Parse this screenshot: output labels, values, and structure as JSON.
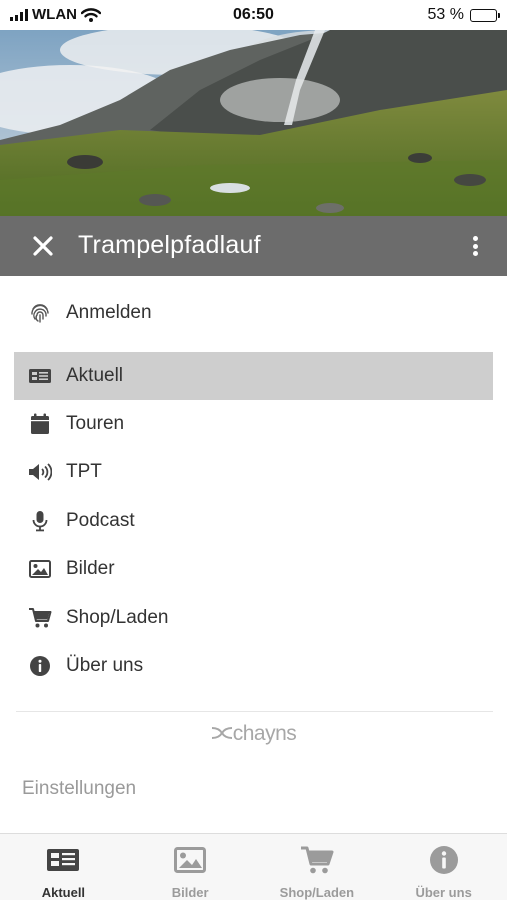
{
  "status_bar": {
    "carrier": "WLAN",
    "time": "06:50",
    "battery_percent": "53 %",
    "battery_level": 0.53
  },
  "header": {
    "title": "Trampelpfadlauf",
    "background": "#6c6c6c"
  },
  "login": {
    "label": "Anmelden",
    "icon": "fingerprint-icon"
  },
  "menu": {
    "items": [
      {
        "label": "Aktuell",
        "icon": "newspaper-icon",
        "active": true
      },
      {
        "label": "Touren",
        "icon": "calendar-icon",
        "active": false
      },
      {
        "label": "TPT",
        "icon": "speaker-icon",
        "active": false
      },
      {
        "label": "Podcast",
        "icon": "microphone-icon",
        "active": false
      },
      {
        "label": "Bilder",
        "icon": "image-icon",
        "active": false
      },
      {
        "label": "Shop/Laden",
        "icon": "cart-icon",
        "active": false
      },
      {
        "label": "Über uns",
        "icon": "info-icon",
        "active": false
      }
    ],
    "active_background": "#cecece"
  },
  "brand": "chayns",
  "settings_label": "Einstellungen",
  "tabbar": {
    "tabs": [
      {
        "label": "Aktuell",
        "icon": "newspaper-icon",
        "active": true
      },
      {
        "label": "Bilder",
        "icon": "image-icon",
        "active": false
      },
      {
        "label": "Shop/Laden",
        "icon": "cart-icon",
        "active": false
      },
      {
        "label": "Über uns",
        "icon": "info-icon",
        "active": false
      }
    ]
  }
}
